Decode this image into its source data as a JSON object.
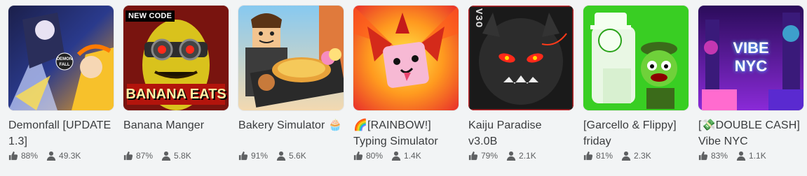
{
  "games": [
    {
      "title": "Demonfall [UPDATE 1.3]",
      "like": "88%",
      "players": "49.3K",
      "thumb_text": "DEMON FALL"
    },
    {
      "title": "Banana Manger",
      "like": "87%",
      "players": "5.8K",
      "badge": "NEW CODE",
      "thumb_text": "BANANA EATS"
    },
    {
      "title": "Bakery Simulator 🧁",
      "like": "91%",
      "players": "5.6K"
    },
    {
      "title": "🌈[RAINBOW!] Typing Simulator",
      "like": "80%",
      "players": "1.4K"
    },
    {
      "title": "Kaiju Paradise v3.0B",
      "like": "79%",
      "players": "2.1K",
      "thumb_text": "V3O"
    },
    {
      "title": "[Garcello & Flippy] friday",
      "like": "81%",
      "players": "2.3K"
    },
    {
      "title": "[💸DOUBLE CASH] Vibe NYC",
      "like": "83%",
      "players": "1.1K",
      "thumb_text": "VIBE NYC"
    }
  ],
  "colors": {
    "background": "#f2f4f5",
    "text": "#393b3d",
    "stat_text": "#5e6062"
  },
  "icons": {
    "like": "thumbs-up-icon",
    "players": "person-icon"
  }
}
